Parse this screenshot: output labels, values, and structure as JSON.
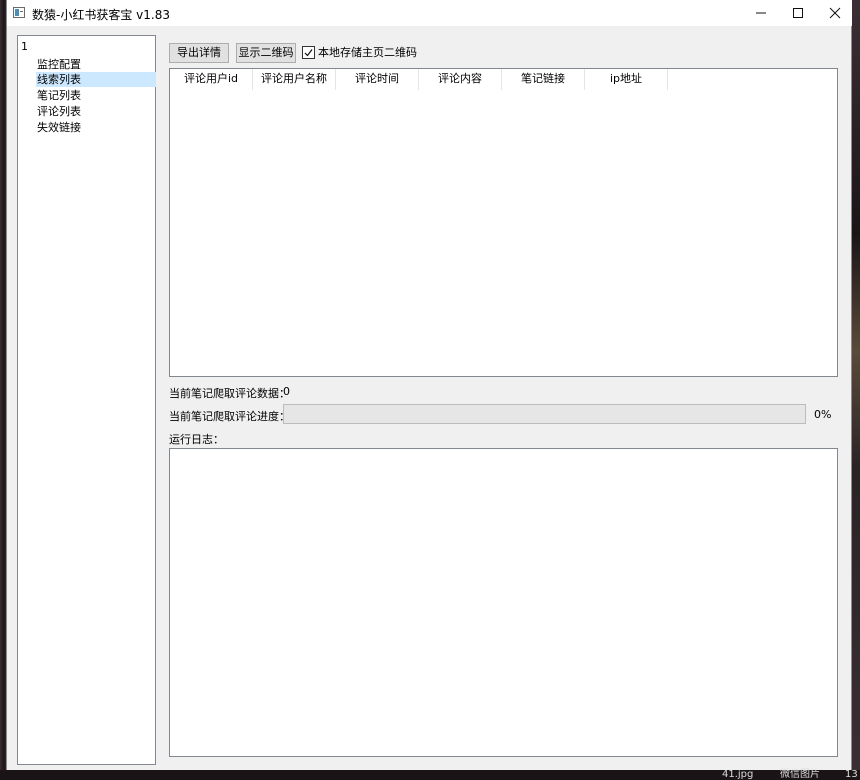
{
  "window": {
    "title": "数猿-小红书获客宝 v1.83"
  },
  "tree": {
    "root": "1",
    "items": [
      "监控配置",
      "线索列表",
      "笔记列表",
      "评论列表",
      "失效链接"
    ],
    "selected_index": 1
  },
  "toolbar": {
    "export_label": "导出详情",
    "qr_label": "显示二维码",
    "checkbox_label": "本地存储主页二维码",
    "checkbox_checked": true
  },
  "table": {
    "columns": [
      "评论用户id",
      "评论用户名称",
      "评论时间",
      "评论内容",
      "笔记链接",
      "ip地址"
    ],
    "rows": []
  },
  "status": {
    "count_label": "当前笔记爬取评论数据：",
    "count_value": "0",
    "progress_label": "当前笔记爬取评论进度：",
    "progress_value": "0%",
    "progress_fraction": 0,
    "log_label": "运行日志："
  },
  "taskbar": {
    "item1": "41.jpg",
    "item2": "微信图片",
    "item3": "13"
  }
}
